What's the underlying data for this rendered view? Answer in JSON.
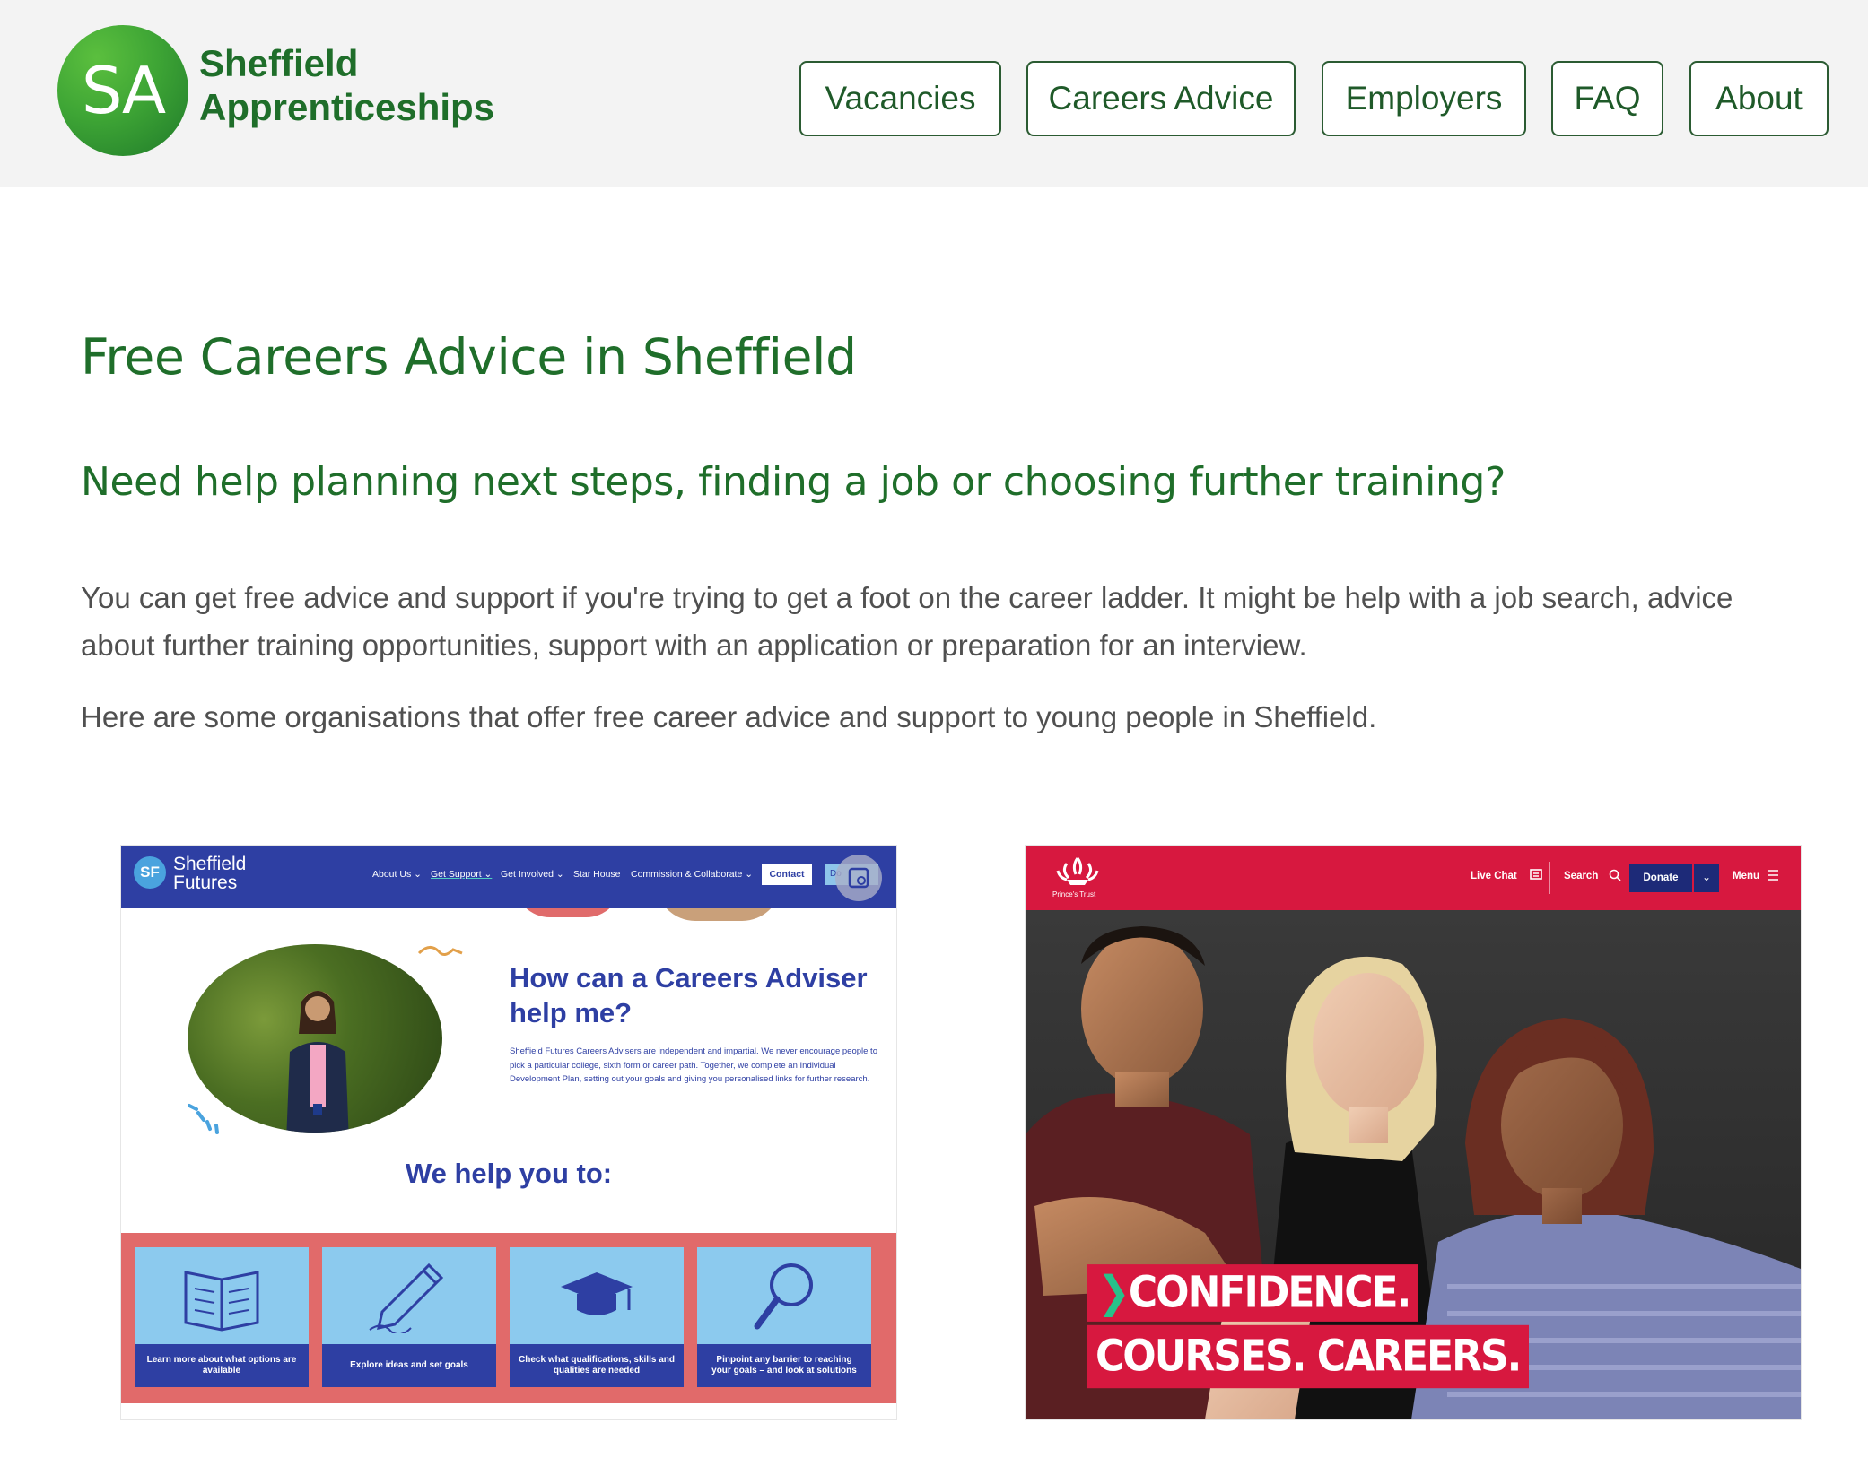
{
  "brand": {
    "logo_text": "SA",
    "name_line1": "Sheffield",
    "name_line2": "Apprenticeships",
    "color": "#1f6e2a"
  },
  "nav": {
    "items": [
      {
        "label": "Vacancies"
      },
      {
        "label": "Careers Advice"
      },
      {
        "label": "Employers"
      },
      {
        "label": "FAQ"
      },
      {
        "label": "About"
      }
    ]
  },
  "main": {
    "title": "Free Careers Advice in Sheffield",
    "subtitle": "Need help planning next steps, finding a job or choosing further training?",
    "intro": "You can get free advice and support if you're trying to get a foot on the career ladder. It might be help with a job search, advice about further training opportunities, support with an application or preparation for an interview.",
    "intro2": "Here are some organisations that offer free career advice and support to young people in Sheffield."
  },
  "sheffield_futures": {
    "logo_text": "SF",
    "name_line1": "Sheffield",
    "name_line2": "Futures",
    "nav": [
      "About Us ⌄",
      "Get Support ⌄",
      "Get Involved ⌄",
      "Star House",
      "Commission & Collaborate ⌄"
    ],
    "contact": "Contact",
    "donate": "Do",
    "heading": "How can a Careers Adviser help me?",
    "body": "Sheffield Futures Careers Advisers are independent and impartial. We never encourage people to pick a particular college, sixth form or career path. Together, we complete an Individual Development Plan, setting out your goals and giving you personalised links for further research.",
    "help_title": "We help you to:",
    "tiles": [
      {
        "caption": "Learn more about what options are available",
        "icon": "book-icon"
      },
      {
        "caption": "Explore ideas and set goals",
        "icon": "pencil-icon"
      },
      {
        "caption": "Check what qualifications, skills and qualities are needed",
        "icon": "graduation-cap-icon"
      },
      {
        "caption": "Pinpoint any barrier to reaching your goals – and look at solutions",
        "icon": "magnifier-icon"
      }
    ],
    "color": "#2e3fa3"
  },
  "princes_trust": {
    "crest_name": "Prince's Trust",
    "live_chat": "Live Chat",
    "search": "Search",
    "donate": "Donate",
    "menu": "Menu",
    "tag_line1": "CONFIDENCE.",
    "tag_line2": "COURSES. CAREERS.",
    "tag_arrow": "❯",
    "color": "#d7183f"
  }
}
